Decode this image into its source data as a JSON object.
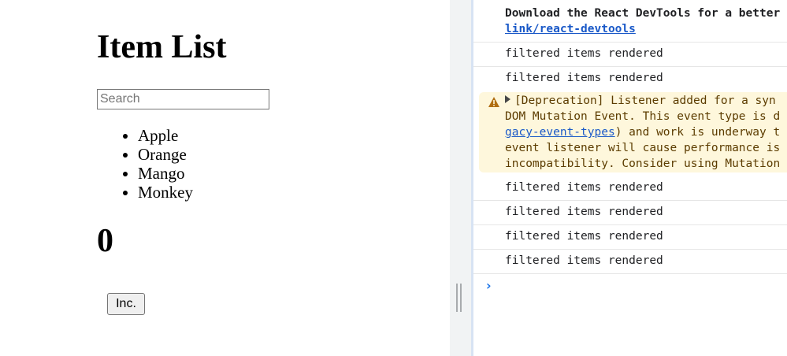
{
  "app": {
    "title": "Item List",
    "search": {
      "placeholder": "Search",
      "value": ""
    },
    "items": [
      "Apple",
      "Orange",
      "Mango",
      "Monkey"
    ],
    "count": "0",
    "inc_label": "Inc."
  },
  "console": {
    "devtools_text": "Download the React DevTools for a better",
    "devtools_link": "link/react-devtools",
    "log_message": "filtered items rendered",
    "warning": {
      "line1": "[Deprecation] Listener added for a syn",
      "line2": "DOM Mutation Event. This event type is d",
      "line3_link": "gacy-event-types",
      "line3_rest": ") and work is underway t",
      "line4": "event listener will cause performance is",
      "line5": "incompatibility. Consider using Mutation"
    }
  },
  "colors": {
    "link": "#1a59c8",
    "warning_bg": "#fef7dc",
    "warning_icon": "#b06e12",
    "prompt": "#1a73e8"
  }
}
